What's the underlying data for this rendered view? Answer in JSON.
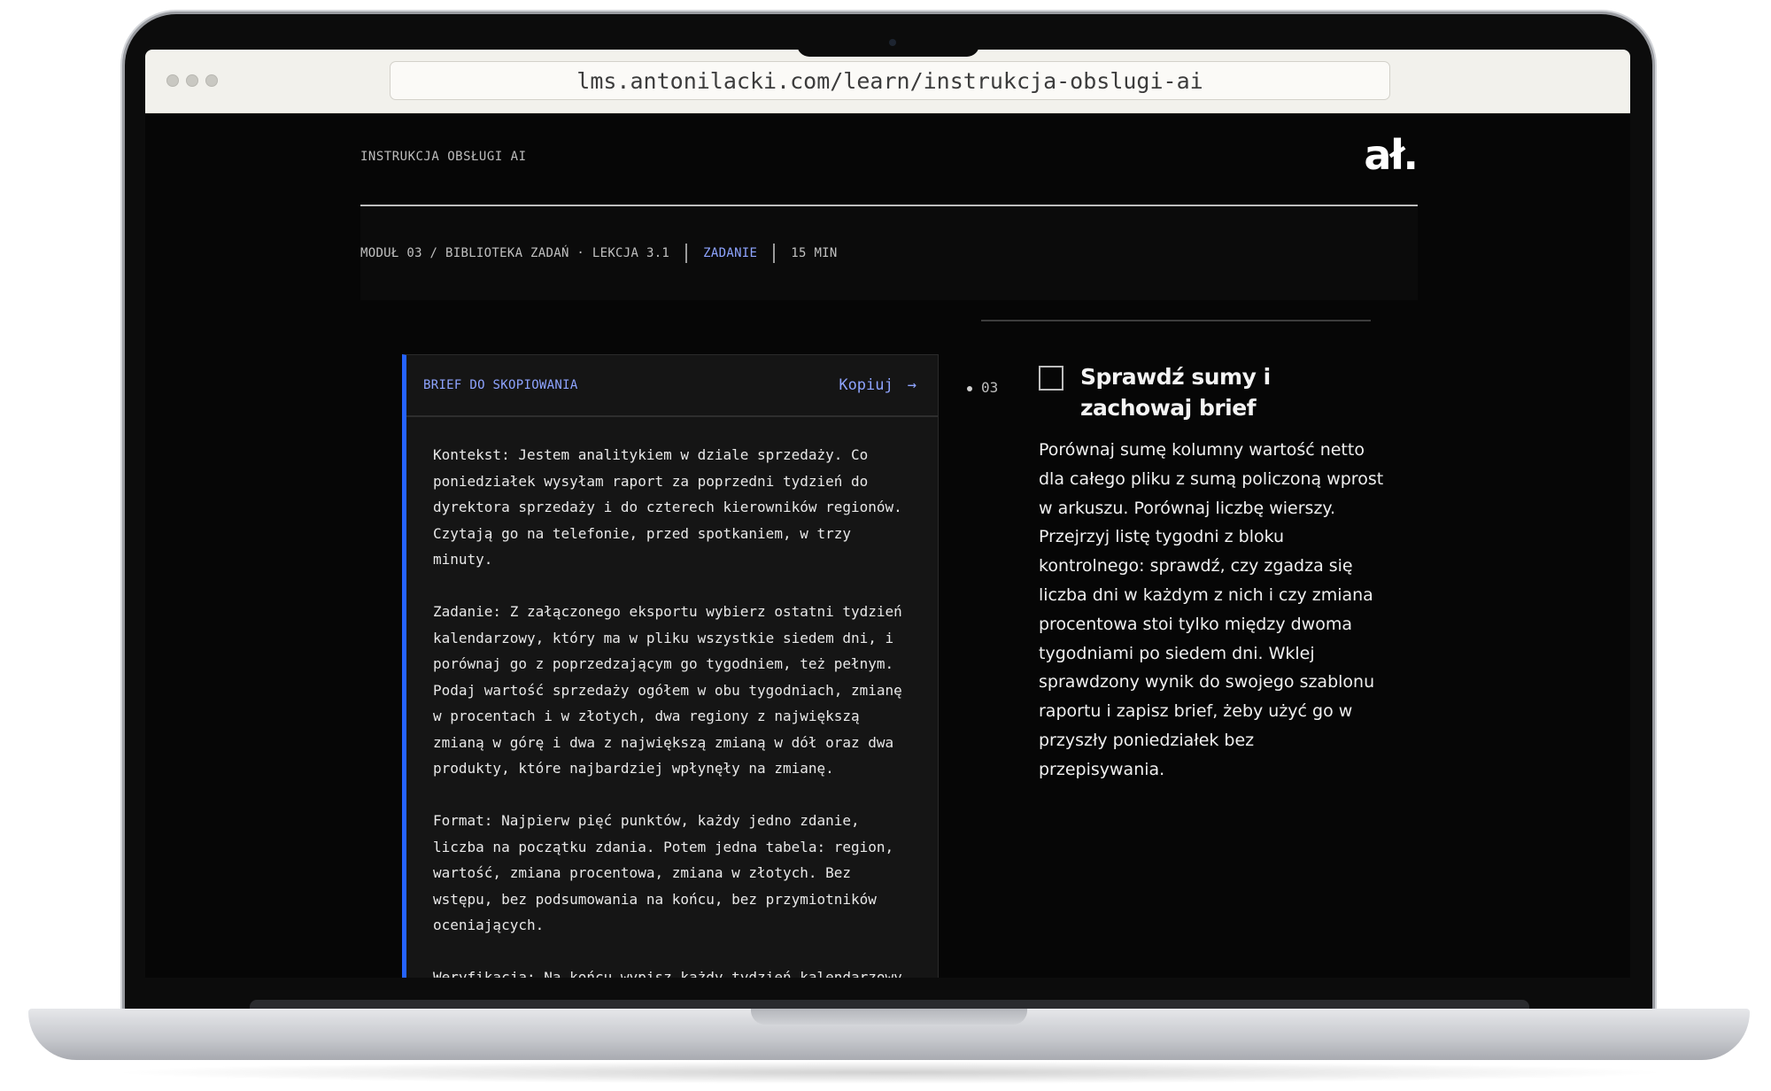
{
  "browser": {
    "url": "lms.antonilacki.com/learn/instrukcja-obslugi-ai"
  },
  "header": {
    "site_label": "INSTRUKCJA OBSŁUGI AI",
    "logo_text": "ał."
  },
  "meta": {
    "breadcrumb": "MODUŁ 03 / BIBLIOTEKA ZADAŃ · LEKCJA 3.1",
    "type": "ZADANIE",
    "duration": "15 MIN",
    "accent_color": "#8ea4ff"
  },
  "brief": {
    "title": "BRIEF DO SKOPIOWANIA",
    "copy_label": "Kopiuj",
    "copy_arrow": "→",
    "border_color": "#2563ff",
    "body": "Kontekst: Jestem analitykiem w dziale sprzedaży. Co\nponiedziałek wysyłam raport za poprzedni tydzień do\ndyrektora sprzedaży i do czterech kierowników regionów.\nCzytają go na telefonie, przed spotkaniem, w trzy\nminuty.\n\nZadanie: Z załączonego eksportu wybierz ostatni tydzień\nkalendarzowy, który ma w pliku wszystkie siedem dni, i\nporównaj go z poprzedzającym go tygodniem, też pełnym.\nPodaj wartość sprzedaży ogółem w obu tygodniach, zmianę\nw procentach i w złotych, dwa regiony z największą\nzmianą w górę i dwa z największą zmianą w dół oraz dwa\nprodukty, które najbardziej wpłynęły na zmianę.\n\nFormat: Najpierw pięć punktów, każdy jedno zdanie,\nliczba na początku zdania. Potem jedna tabela: region,\nwartość, zmiana procentowa, zmiana w złotych. Bez\nwstępu, bez podsumowania na końcu, bez przymiotników\noceniających.\n\nWeryfikacja: Na końcu wypisz każdy tydzień kalendarzowy"
  },
  "step": {
    "number": "03",
    "checked": false,
    "title": "Sprawdź sumy i zachowaj brief",
    "text": "Porównaj sumę kolumny wartość netto dla całego pliku z sumą policzoną wprost w arkuszu. Porównaj liczbę wierszy. Przejrzyj listę tygodni z bloku kontrolnego: sprawdź, czy zgadza się liczba dni w każdym z nich i czy zmiana procentowa stoi tylko między dwoma tygodniami po siedem dni. Wklej sprawdzony wynik do swojego szablonu raportu i zapisz brief, żeby użyć go w przyszły poniedziałek bez przepisywania."
  }
}
